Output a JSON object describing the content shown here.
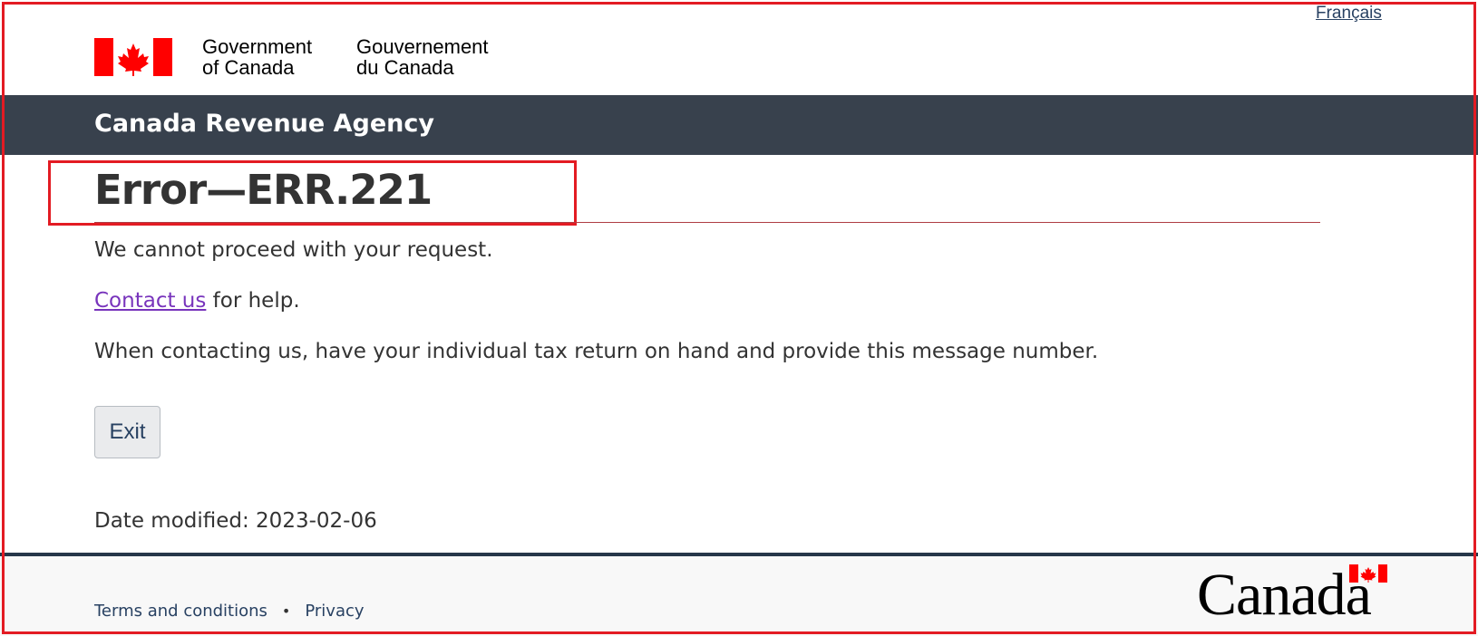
{
  "header": {
    "language_toggle": "Français",
    "signature_en": "Government\nof Canada",
    "signature_fr": "Gouvernement\ndu Canada",
    "agency": "Canada Revenue Agency"
  },
  "main": {
    "title": "Error—ERR.221",
    "message": "We cannot proceed with your request.",
    "contact_link": "Contact us",
    "contact_suffix": " for help.",
    "instructions": "When contacting us, have your individual tax return on hand and provide this message number.",
    "exit_label": "Exit",
    "date_modified": "Date modified: 2023-02-06"
  },
  "footer": {
    "links": [
      "Terms and conditions",
      "Privacy"
    ],
    "separator": "•",
    "wordmark": "Canada"
  },
  "colors": {
    "flag_red": "#ff0000",
    "agency_bar": "#38414d",
    "highlight_frame": "#e31b23",
    "visited_link": "#7834bc",
    "link": "#284162"
  },
  "icons": {
    "flag": "canada-flag-icon",
    "wordmark_flag": "canada-wordmark-flag-icon"
  }
}
